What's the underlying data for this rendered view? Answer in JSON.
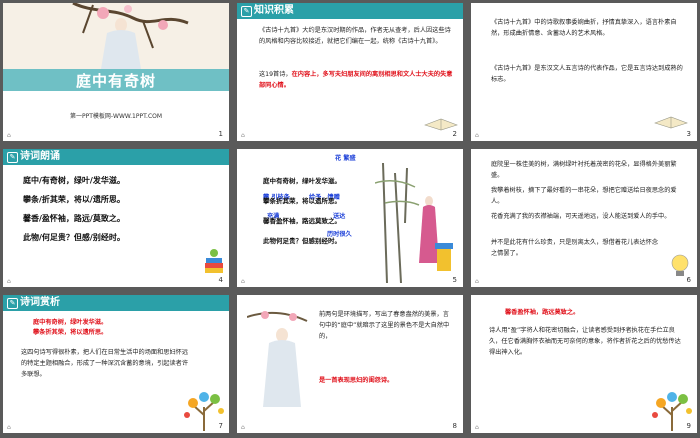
{
  "slides": [
    {
      "number": "1",
      "title": "庭中有奇树",
      "subtitle": "第一PPT模板网-WWW.1PPT.COM"
    },
    {
      "number": "2",
      "header": "知识积累",
      "p1": "《古诗十九首》大约是东汉时期的作品，作者无从查考，后人因这些诗的风格和内容比较接近，就把它们编在一起，统称《古诗十九首》。",
      "p2_prefix": "这19首诗，",
      "p2_red": "在内容上，多写夫妇朋友间的离别相思和文人士大夫的失意部同心情。"
    },
    {
      "number": "3",
      "p1": "《古诗十九首》中的诗歌叙事委婉曲折，抒情真挚深入，语言朴素自然，形成曲折情意、含蓄动人的艺术风格。",
      "p2": "《古诗十九首》是东汉文人五言诗的代表作品，它是五言诗达到成熟的标志。"
    },
    {
      "number": "4",
      "header": "诗词朗诵",
      "lines": [
        "庭中/有奇树，绿叶/发华滋。",
        "攀条/折其荣，将以/遗所思。",
        "馨香/盈怀袖，路远/莫致之。",
        "此物/何足贵？但感/别经时。"
      ]
    },
    {
      "number": "5",
      "labels": [
        "花 繁盛",
        "攀 引枝条",
        "给予，馈赠",
        "充满",
        "送达",
        "历时很久"
      ],
      "lines": [
        "庭中有奇树，绿叶发华滋。",
        "攀条折其荣，将以遗所思。",
        "馨香盈怀袖，路远莫致之。",
        "此物何足贵？但感别经时。"
      ]
    },
    {
      "number": "6",
      "p1": "庭院里一株佳美的树，满树绿叶衬托着茂密的花朵，显得格外美丽繁盛。",
      "p2": "我攀着树枝，摘下了最好看的一串花朵，想把它赠送给日夜思念的爱人。",
      "p3": "花香充满了我的衣襟袖端，可天遥地远，没人能送到爱人的手中。",
      "p4": "并不是此花有什么珍贵，只是别离太久，想借着花儿表达怀念之情罢了。"
    },
    {
      "number": "7",
      "header": "诗词赏析",
      "quote1": "庭中有奇树，绿叶发华滋。",
      "quote2": "攀条折其荣，将以遗所思。",
      "p1": "这四句诗写得很朴素，把人们在日常生活中的场面和思妇怀远的特定主题相融合，形成了一种深沉含蓄的意境，引起读者许多联想。"
    },
    {
      "number": "8",
      "p1": "前两句是环境描写，写出了春意盎然的美景，言句中的“庭中”就暗示了这里的景色不是大自然中的，",
      "p1_red": "是一首表现思妇的闺怨诗。"
    },
    {
      "number": "9",
      "heading": "馨香盈怀袖，路远莫致之。",
      "p1": "诗人用“盈”字将人和花密切融合，让读者感受到抒者执花在手伫立良久，任它香满胸怀衣袖而无可奈何的意象，将作者折花之后的忧愁传达得出神入化。"
    }
  ],
  "colors": {
    "accent": "#2ba0a8",
    "red": "#e0101a",
    "blue": "#1b3fd8",
    "background": "#5a5a5a"
  }
}
